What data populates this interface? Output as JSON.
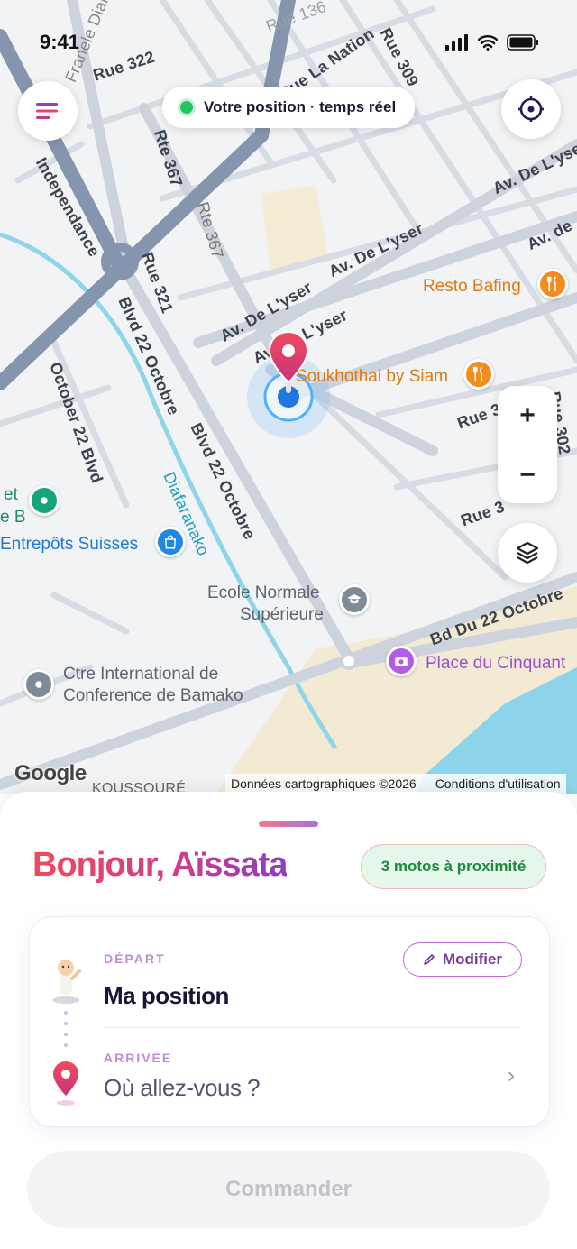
{
  "status": {
    "time": "9:41"
  },
  "map": {
    "live_label": "Votre position · temps réel",
    "zoom_in": "+",
    "zoom_out": "−",
    "google": "Google",
    "attribution": "Données cartographiques ©2026",
    "terms": "Conditions d'utilisation",
    "roads": [
      "Rue 322",
      "Rue 136",
      "Rue La Nation",
      "Rue 309",
      "Rte 367",
      "Rte 367",
      "Rue 321",
      "Av. De L'yser",
      "Av. De L'yser",
      "Av. De L'yser",
      "Av. De L'yser",
      "Av. de",
      "Blvd 22 Octobre",
      "Blvd 22 Octobre",
      "October 22 Blvd",
      "Diafaranako",
      "Bd Du 22 Octobre",
      "Independance",
      "Rue 3",
      "Rue 3",
      "Rue 302",
      "Franele Diarra",
      "KOUSSOURÉ"
    ],
    "pois": {
      "resto": "Resto Bafing",
      "siam": "Soukhothai by Siam",
      "entrepots": "Entrepôts Suisses",
      "ecole_line1": "Ecole Normale",
      "ecole_line2": "Supérieure",
      "place": "Place du Cinquant",
      "ctre_line1": "Ctre International de",
      "ctre_line2": "Conference de Bamako",
      "partial": "et",
      "partial2": "e B"
    }
  },
  "sheet": {
    "greeting": "Bonjour, Aïssata",
    "nearby_badge": "3 motos à proximité",
    "departure_label": "DÉPART",
    "departure_value": "Ma position",
    "edit_label": "Modifier",
    "arrival_label": "ARRIVÉE",
    "arrival_placeholder": "Où allez-vous ?",
    "order_button": "Commander"
  },
  "colors": {
    "accent_pink": "#e8407a",
    "accent_purple": "#8a3fc4",
    "live_green": "#22c55e",
    "poi_orange": "#f28c1c",
    "poi_blue": "#1e88e5",
    "poi_purple": "#b45ce8"
  }
}
